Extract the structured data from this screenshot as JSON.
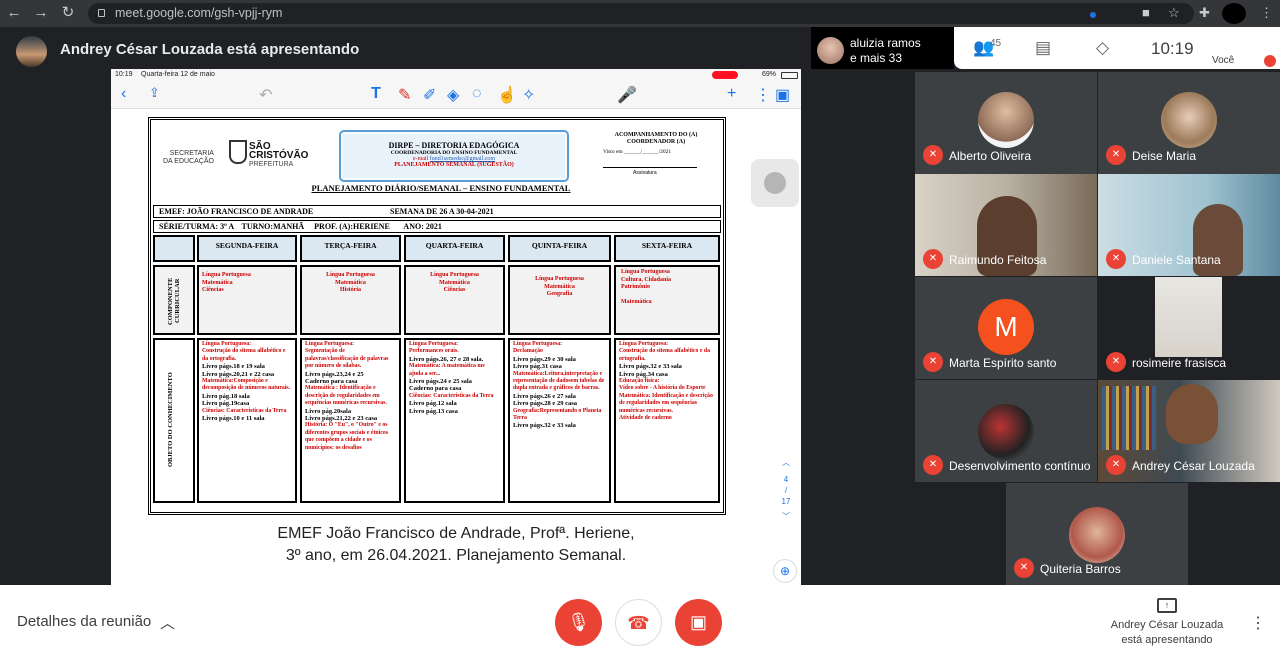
{
  "browser": {
    "url": "meet.google.com/gsh-vpjj-rym",
    "back_icon": "arrow-left",
    "forward_icon": "arrow-right",
    "reload_icon": "reload"
  },
  "presenter_bar": {
    "title": "Andrey César Louzada está apresentando"
  },
  "top": {
    "others_name": "aluizia ramos",
    "others_more": "e mais 33",
    "participant_count": "45",
    "time": "10:19",
    "self_label": "Você"
  },
  "ipad": {
    "status_time": "10:19",
    "status_date": "Quarta-feira 12 de maio",
    "battery": "69%"
  },
  "doc": {
    "secretaria": "SECRETARIA\nDA EDUCAÇÃO",
    "sc_title": "SÃO\nCRISTÓVÃO",
    "prefeitura": "PREFEITURA",
    "dirpe": "DIRPE – DIRETORIA EDAGÓGICA",
    "coord": "COORDENADORIA DO ENSINO FUNDAMENTAL",
    "email_label": "e-mail",
    "email": "fund1semedsc@gmail.com",
    "plan_sug": "PLANEJAMENTO SEMANAL (SUGESTÃO)",
    "acomp": "ACOMPANHAMENTO DO (A) COORDENADOR (A)",
    "visto": "Visto em ______/______/2021",
    "assinatura": "Assinatura",
    "plan_title": "PLANEJAMENTO DIÁRIO/SEMANAL – ENSINO FUNDAMENTAL",
    "emef": "EMEF: JOÃO FRANCISCO DE ANDRADE",
    "semana": "SEMANA DE   26 A 30-04-2021",
    "serie": "SÉRIE/TURMA: 3º A    TURNO:MANHÃ     PROF. (A):HERIENE       ANO: 2021",
    "days": [
      "SEGUNDA-FEIRA",
      "TERÇA-FEIRA",
      "QUARTA-FEIRA",
      "QUINTA-FEIRA",
      "SEXTA-FEIRA"
    ],
    "componente_label": "COMPONENTE CURRICULAR",
    "objeto_label": "OBJETO DO CONHECIMENTO",
    "componentes": [
      "Língua Portuguesa\nMatemática\nCiências",
      "Língua Portuguesa\nMatemática\nHistória",
      "Língua Portuguesa\nMatemática\nCiências",
      "Língua Portuguesa\nMatemática\nGeografia",
      "Língua Portuguesa\nCultura,     Cidadania\nPatrimônio\n\nMatemática"
    ],
    "objetos": [
      "Língua Portuguesa:|Construção do sitema alfabético e da ortografia.|Livro págs.18 e 19 sala|Livro págs.20,21 e 22 casa|Matemática:Composição e decomposição de números naturais.|Livro pág.18 sala|Livro pág.19casa|Ciências: Características da Terra|Livro págs.10 e 11 sala",
      "Língua Portuguesa:|Segmentação de palavras/classificação de palavras por número de sílabas.|Livro págs.23,24 e 25|Caderno para casa|Matemática : Identificação e descrição de regularidades em sequências numéricas recursivas.|Livro pág.20sala|Livro págs.21,22 e 23 casa|História: O \"Eu\", o \"Outro\" e os diferentes grupos sociais e étnicos que compõem a cidade e os municípios: os desafios",
      "Língua Portuguesa:|Performances orais.|Livro págs.26, 27 e 28 sala.|Matemática: A matemática me ajuda a ser...|Livro págs.24 e 25 sala|Caderno para casa|Ciências: Características da Terra|Livro pág.12 sala|Livro pág.13 casa",
      "Língua Portuguesa:|Declamação|Livro págs.29 e 30 sala|Livro pág.31 casa|Matemática:Leitura,interpretação e representação de dadosem tabelas de dupla entrada e gráficos de barras.|Livro págs.26 e 27 sala|Livro págs.28 e 29 casa|Geografia:Representando o Planeta Terra|Livro págs.32 e 33 sala",
      "Língua Portuguesa:|Construção do sitema alfabético e da ortografia.|Livro págs.32 e 33 sala|Livro pág.34 casa|Educação física:|Vídeo sobre - A história do Esporte|Matemática: Identificação e descrição de regularidades em sequências numéricas recursivas.|Atividade de caderno"
    ]
  },
  "caption": {
    "line1": "EMEF João Francisco de Andrade, Profª. Heriene,",
    "line2": "3º ano, em 26.04.2021. Planejamento Semanal."
  },
  "page": {
    "current": "4",
    "sep": "/",
    "total": "17"
  },
  "participants": [
    {
      "name": "Alberto Oliveira"
    },
    {
      "name": "Deise Maria"
    },
    {
      "name": "Raimundo Feitosa"
    },
    {
      "name": "Daniele Santana"
    },
    {
      "name": "Marta Espírito santo",
      "initial": "M"
    },
    {
      "name": "rosimeire frasisca"
    },
    {
      "name": "Desenvolvimento contínuo"
    },
    {
      "name": "Andrey César Louzada"
    },
    {
      "name": "Quiteria Barros"
    }
  ],
  "bottom": {
    "details": "Detalhes da reunião",
    "presenting_line1": "Andrey César Louzada",
    "presenting_line2": "está apresentando"
  },
  "colors": {
    "red": "#ea4335",
    "blue": "#1a73e8",
    "dark": "#202124"
  }
}
